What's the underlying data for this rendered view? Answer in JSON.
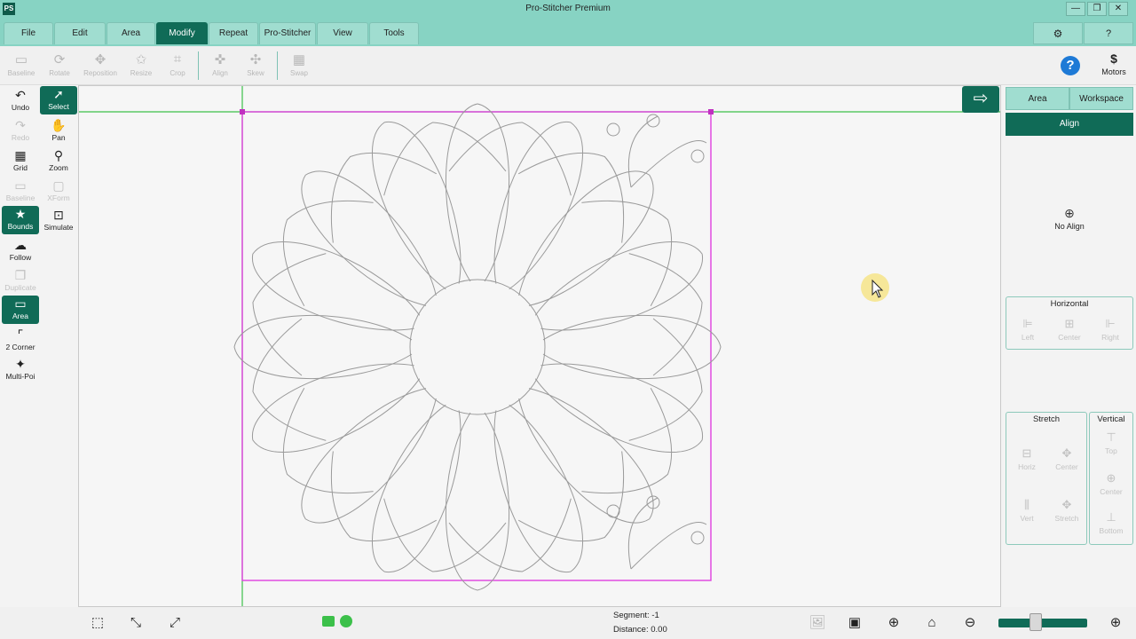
{
  "title": {
    "app_icon": "PS",
    "text": "Pro-Stitcher Premium",
    "minimize": "—",
    "maximize": "❐",
    "close": "✕"
  },
  "menu": {
    "tabs": [
      {
        "label": "File"
      },
      {
        "label": "Edit"
      },
      {
        "label": "Area"
      },
      {
        "label": "Modify"
      },
      {
        "label": "Repeat"
      },
      {
        "label": "Pro-Stitcher"
      },
      {
        "label": "View"
      },
      {
        "label": "Tools"
      }
    ],
    "active": "Modify",
    "settings_icon": "gear-icon",
    "help_icon": "question-icon"
  },
  "toolbar": {
    "items": [
      {
        "label": "Baseline",
        "icon": "baseline-icon"
      },
      {
        "label": "Rotate",
        "icon": "rotate-icon"
      },
      {
        "label": "Reposition",
        "icon": "reposition-icon"
      },
      {
        "label": "Resize",
        "icon": "resize-icon"
      },
      {
        "label": "Crop",
        "icon": "crop-icon"
      },
      {
        "label": "Align",
        "icon": "align-icon"
      },
      {
        "label": "Skew",
        "icon": "skew-icon"
      },
      {
        "label": "Swap",
        "icon": "swap-icon"
      }
    ],
    "help_label": "?",
    "motors": {
      "label": "Motors",
      "icon": "$"
    }
  },
  "left_tools": {
    "undo": "Undo",
    "select": "Select",
    "redo": "Redo",
    "pan": "Pan",
    "grid": "Grid",
    "zoom": "Zoom",
    "baseline": "Baseline",
    "xform": "XForm",
    "bounds": "Bounds",
    "simulate": "Simulate",
    "follow": "Follow",
    "duplicate": "Duplicate",
    "area": "Area",
    "two_corner": "2 Corner",
    "multi_point": "Multi-Poi"
  },
  "right_panel": {
    "tabs": [
      {
        "label": "Area"
      },
      {
        "label": "Workspace"
      }
    ],
    "header": "Align",
    "no_align": "No Align",
    "horizontal": {
      "title": "Horizontal",
      "buttons": [
        "Left",
        "Center",
        "Right"
      ]
    },
    "stretch": {
      "title": "Stretch",
      "buttons": [
        "Horiz",
        "Center",
        "Vert",
        "Stretch"
      ]
    },
    "vertical": {
      "title": "Vertical",
      "buttons": [
        "Top",
        "Center",
        "Bottom"
      ]
    }
  },
  "status": {
    "segment_label": "Segment:",
    "segment_value": "-1",
    "distance_label": "Distance:",
    "distance_value": "0.00",
    "zoom_level": 0.42
  },
  "colors": {
    "accent": "#106b57",
    "menu_bg": "#87d3c3",
    "selection": "#e040e0",
    "guide": "#3cc04a",
    "stitch": "#9a9a9a"
  }
}
